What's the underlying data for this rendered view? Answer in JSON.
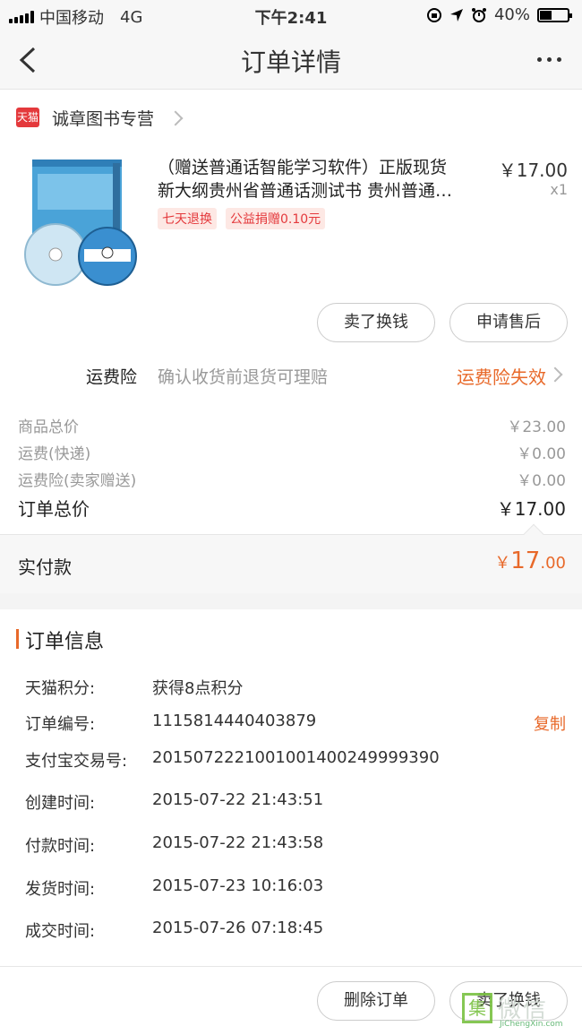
{
  "status_bar": {
    "carrier": "中国移动",
    "network": "4G",
    "time": "下午2:41",
    "battery": "40%"
  },
  "nav": {
    "title": "订单详情"
  },
  "store": {
    "badge": "天猫",
    "name": "诚章图书专营"
  },
  "product": {
    "title_line1": "（赠送普通话智能学习软件）正版现货",
    "title_line2": "新大纲贵州省普通话测试书 贵州普通…",
    "price": "￥17.00",
    "quantity": "x1",
    "tags": [
      "七天退换",
      "公益捐赠0.10元"
    ]
  },
  "product_actions": {
    "sell": "卖了换钱",
    "after_sale": "申请售后"
  },
  "insurance": {
    "label": "运费险",
    "desc": "确认收货前退货可理赔",
    "status": "运费险失效"
  },
  "totals": [
    {
      "label": "商品总价",
      "value": "￥23.00"
    },
    {
      "label": "运费(快递)",
      "value": "￥0.00"
    },
    {
      "label": "运费险(卖家赠送)",
      "value": "￥0.00"
    }
  ],
  "order_total": {
    "label": "订单总价",
    "value": "￥17.00"
  },
  "paid": {
    "label": "实付款",
    "currency": "￥",
    "integer": "17",
    "decimal": ".00"
  },
  "order_info": {
    "title": "订单信息",
    "rows": [
      {
        "key": "天猫积分:",
        "value": "获得8点积分"
      },
      {
        "key": "订单编号:",
        "value": "1115814440403879",
        "action": "复制"
      },
      {
        "key": "支付宝交易号:",
        "value": "2015072221001001400249999390"
      },
      {
        "key": "创建时间:",
        "value": "2015-07-22 21:43:51"
      },
      {
        "key": "付款时间:",
        "value": "2015-07-22 21:43:58"
      },
      {
        "key": "发货时间:",
        "value": "2015-07-23 10:16:03"
      },
      {
        "key": "成交时间:",
        "value": "2015-07-26 07:18:45"
      }
    ]
  },
  "footer": {
    "delete": "删除订单",
    "sell": "卖了换钱"
  },
  "watermark": {
    "char": "集",
    "text": "微信",
    "url": "JiChengXin.com"
  },
  "colors": {
    "accent": "#e8692a",
    "tmall_red": "#e4393c"
  }
}
